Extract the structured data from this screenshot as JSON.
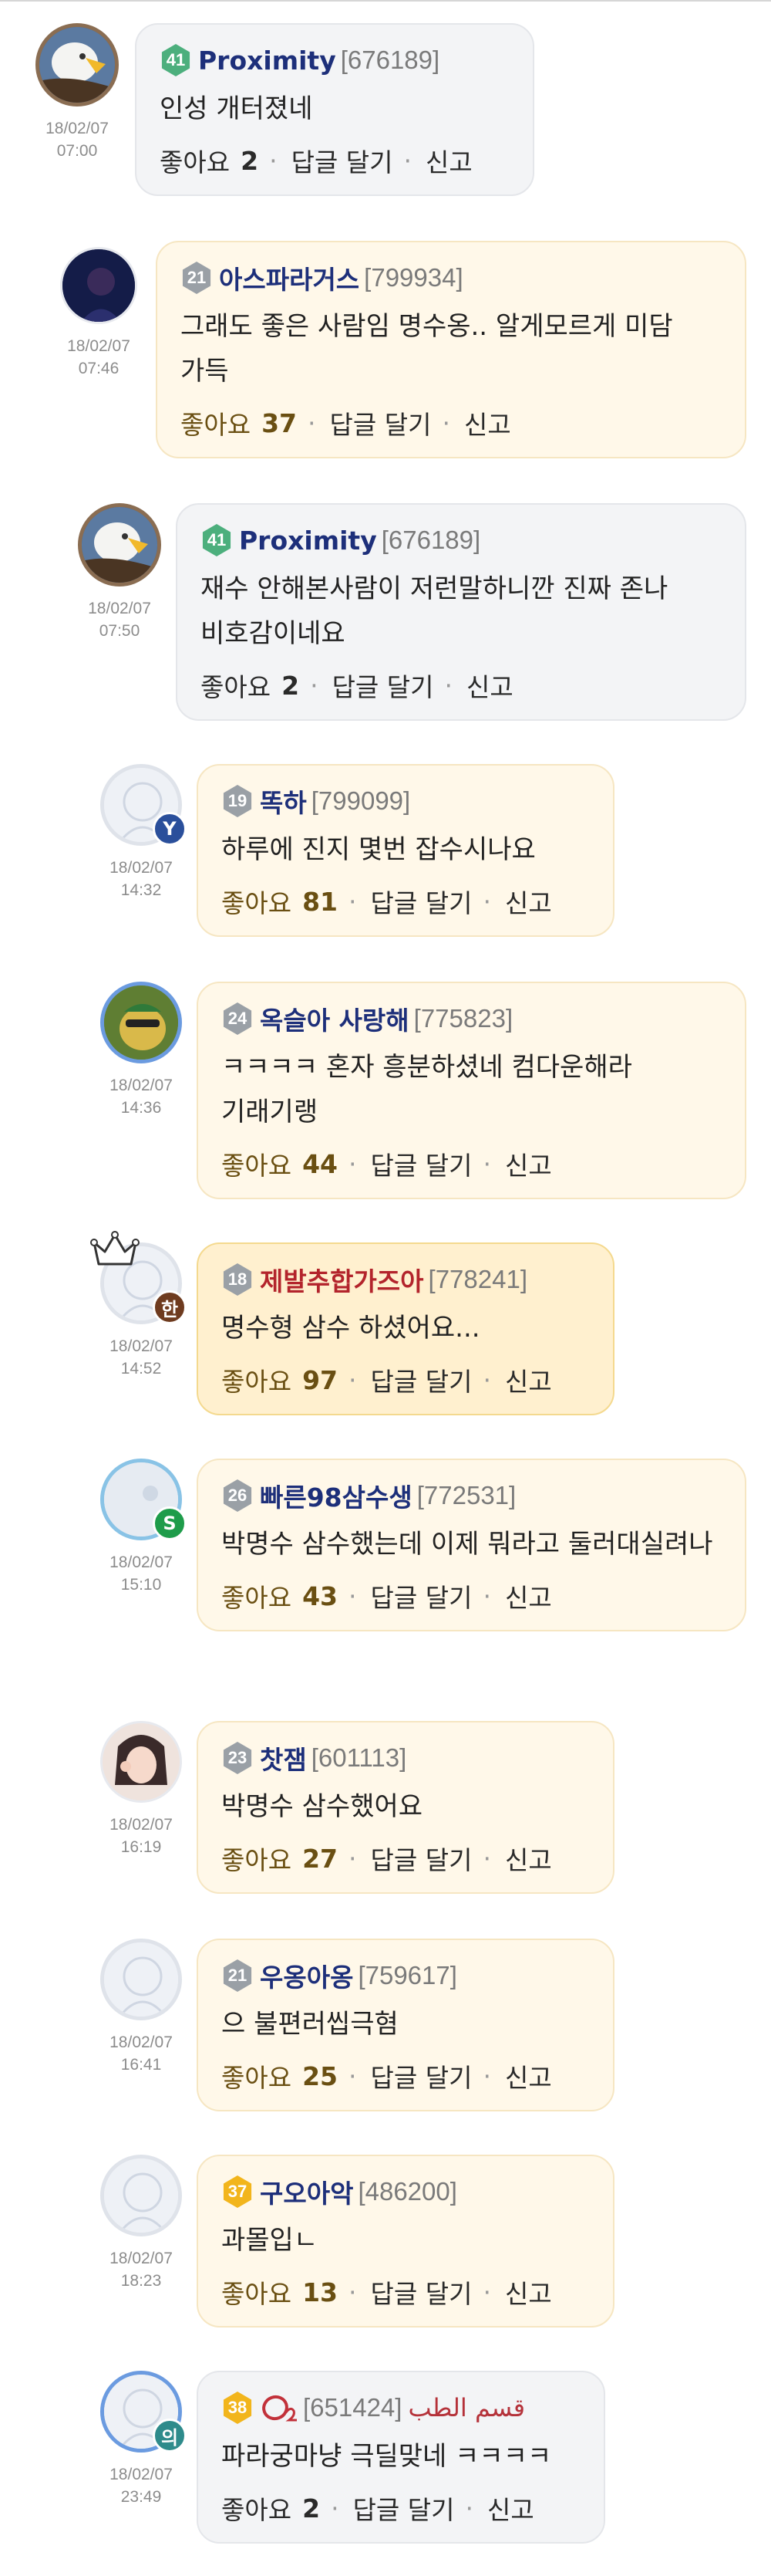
{
  "comments": [
    {
      "nick": "Proximity",
      "uid": "[676189]",
      "level": "41",
      "date": "18/02/07",
      "time": "07:00",
      "text": "인성 개터졌네",
      "likes_label": "좋아요",
      "likes": "2",
      "reply": "답글 달기",
      "report": "신고"
    },
    {
      "nick": "아스파라거스",
      "uid": "[799934]",
      "level": "21",
      "date": "18/02/07",
      "time": "07:46",
      "text": "그래도 좋은 사람임 명수옹.. 알게모르게 미담 가득",
      "likes_label": "좋아요",
      "likes": "37",
      "reply": "답글 달기",
      "report": "신고"
    },
    {
      "nick": "Proximity",
      "uid": "[676189]",
      "level": "41",
      "date": "18/02/07",
      "time": "07:50",
      "text": "재수 안해본사람이 저런말하니깐 진짜 존나 비호감이네요",
      "likes_label": "좋아요",
      "likes": "2",
      "reply": "답글 달기",
      "report": "신고"
    },
    {
      "nick": "똑하",
      "uid": "[799099]",
      "level": "19",
      "badge": "Y",
      "date": "18/02/07",
      "time": "14:32",
      "text": "하루에 진지 몇번 잡수시나요",
      "likes_label": "좋아요",
      "likes": "81",
      "reply": "답글 달기",
      "report": "신고"
    },
    {
      "nick": "옥슬아 사랑해",
      "uid": "[775823]",
      "level": "24",
      "date": "18/02/07",
      "time": "14:36",
      "text": "ㅋㅋㅋㅋ 혼자 흥분하셨네 컴다운해라 기래기랭",
      "likes_label": "좋아요",
      "likes": "44",
      "reply": "답글 달기",
      "report": "신고"
    },
    {
      "nick": "제발추합가즈아",
      "uid": "[778241]",
      "level": "18",
      "badge": "한",
      "date": "18/02/07",
      "time": "14:52",
      "text": "명수형 삼수 하셨어요...",
      "likes_label": "좋아요",
      "likes": "97",
      "reply": "답글 달기",
      "report": "신고"
    },
    {
      "nick": "빠른98삼수생",
      "uid": "[772531]",
      "level": "26",
      "badge": "S",
      "date": "18/02/07",
      "time": "15:10",
      "text": "박명수 삼수했는데 이제 뭐라고 둘러대실려나",
      "likes_label": "좋아요",
      "likes": "43",
      "reply": "답글 달기",
      "report": "신고"
    },
    {
      "nick": "찻잼",
      "uid": "[601113]",
      "level": "23",
      "date": "18/02/07",
      "time": "16:19",
      "text": "박명수 삼수했어요",
      "likes_label": "좋아요",
      "likes": "27",
      "reply": "답글 달기",
      "report": "신고"
    },
    {
      "nick": "우옹아옹",
      "uid": "[759617]",
      "level": "21",
      "date": "18/02/07",
      "time": "16:41",
      "text": "으 불편러씹극혐",
      "likes_label": "좋아요",
      "likes": "25",
      "reply": "답글 달기",
      "report": "신고"
    },
    {
      "nick": "구오아악",
      "uid": "[486200]",
      "level": "37",
      "date": "18/02/07",
      "time": "18:23",
      "text": "과몰입ㄴ",
      "likes_label": "좋아요",
      "likes": "13",
      "reply": "답글 달기",
      "report": "신고"
    },
    {
      "nick": "O2",
      "uid": "[651424]",
      "arabic": "قسم الطب",
      "level": "38",
      "badge": "의",
      "date": "18/02/07",
      "time": "23:49",
      "text": "파라궁마냥 극딜맞네 ㅋㅋㅋㅋ",
      "likes_label": "좋아요",
      "likes": "2",
      "reply": "답글 달기",
      "report": "신고"
    }
  ],
  "colors": {
    "level_green": "#4caf7d",
    "level_grey": "#9aa0a6",
    "level_gold": "#f2b51c",
    "nick": "#1d2f7a",
    "badge_blue": "#2a4f9b",
    "badge_brown": "#6e3b1f",
    "badge_green": "#1e9c4a",
    "badge_teal": "#2e8b8b"
  },
  "icons": [
    "eagle-avatar",
    "crown-icon",
    "level-hexagon-icon"
  ]
}
